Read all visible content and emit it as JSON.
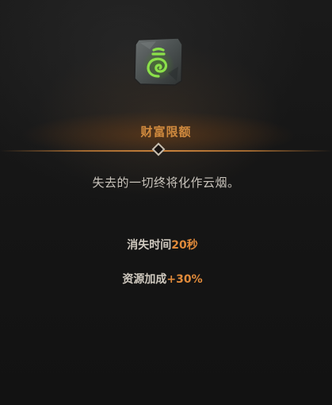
{
  "tooltip": {
    "icon": "green-rune-stone-icon",
    "title": "财富限额",
    "description": "失去的一切终将化作云烟。",
    "stats": [
      {
        "label": "消失时间",
        "value": "20秒"
      },
      {
        "label": "资源加成",
        "value": "+30%"
      }
    ]
  },
  "colors": {
    "title": "#d08a3e",
    "value_accent": "#e08a3a",
    "text": "#c9c4bc",
    "rune_glow": "#7cd641"
  }
}
